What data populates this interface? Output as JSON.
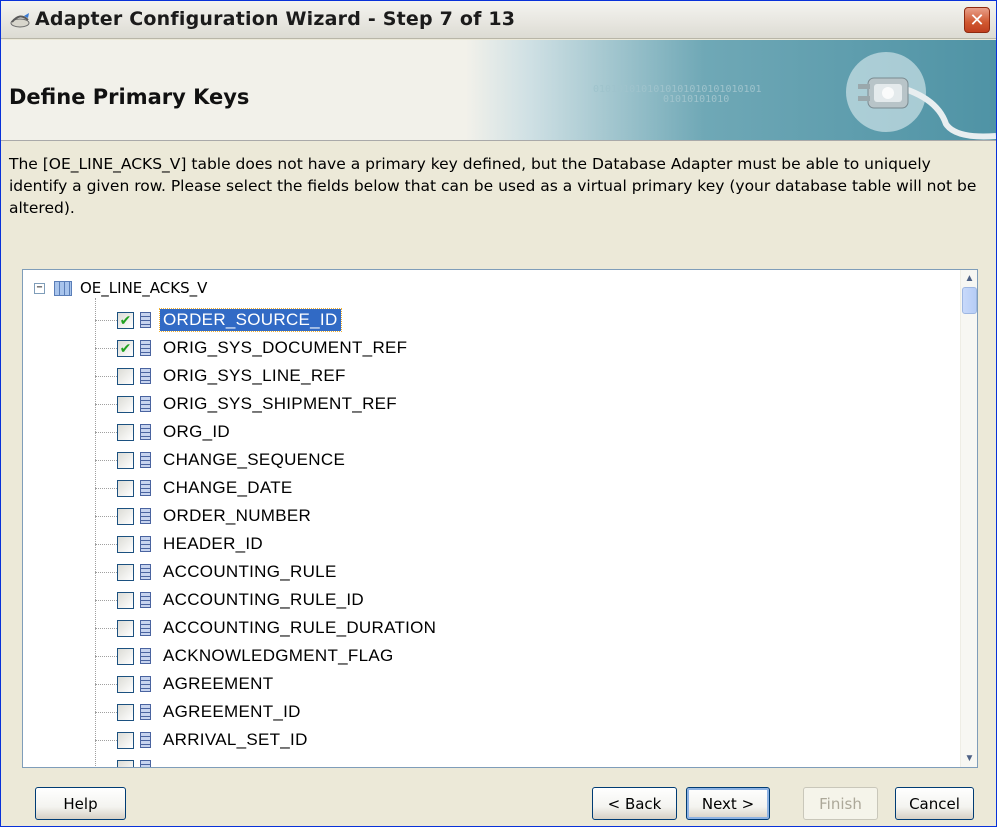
{
  "window": {
    "title": "Adapter Configuration Wizard - Step 7 of 13",
    "close_glyph": "✕"
  },
  "banner": {
    "title": "Define Primary Keys",
    "binary_line1": "0101010101010101010101010101",
    "binary_line2": "01010101010"
  },
  "description": "The [OE_LINE_ACKS_V] table does not have a primary key defined, but the Database Adapter must be able to uniquely identify a given row.  Please select the fields below that can be used as a virtual primary key (your database table will not be altered).",
  "tree": {
    "expander_glyph": "−",
    "root_label": "OE_LINE_ACKS_V",
    "items": [
      {
        "label": "ORDER_SOURCE_ID",
        "checked": true,
        "selected": true
      },
      {
        "label": "ORIG_SYS_DOCUMENT_REF",
        "checked": true,
        "selected": false
      },
      {
        "label": "ORIG_SYS_LINE_REF",
        "checked": false,
        "selected": false
      },
      {
        "label": "ORIG_SYS_SHIPMENT_REF",
        "checked": false,
        "selected": false
      },
      {
        "label": "ORG_ID",
        "checked": false,
        "selected": false
      },
      {
        "label": "CHANGE_SEQUENCE",
        "checked": false,
        "selected": false
      },
      {
        "label": "CHANGE_DATE",
        "checked": false,
        "selected": false
      },
      {
        "label": "ORDER_NUMBER",
        "checked": false,
        "selected": false
      },
      {
        "label": "HEADER_ID",
        "checked": false,
        "selected": false
      },
      {
        "label": "ACCOUNTING_RULE",
        "checked": false,
        "selected": false
      },
      {
        "label": "ACCOUNTING_RULE_ID",
        "checked": false,
        "selected": false
      },
      {
        "label": "ACCOUNTING_RULE_DURATION",
        "checked": false,
        "selected": false
      },
      {
        "label": "ACKNOWLEDGMENT_FLAG",
        "checked": false,
        "selected": false
      },
      {
        "label": "AGREEMENT",
        "checked": false,
        "selected": false
      },
      {
        "label": "AGREEMENT_ID",
        "checked": false,
        "selected": false
      },
      {
        "label": "ARRIVAL_SET_ID",
        "checked": false,
        "selected": false
      },
      {
        "label": "",
        "checked": false,
        "selected": false
      }
    ],
    "scroll_up_glyph": "▲",
    "scroll_down_glyph": "▼"
  },
  "buttons": {
    "help": "Help",
    "back": "< Back",
    "next": "Next >",
    "finish": "Finish",
    "cancel": "Cancel"
  },
  "colors": {
    "selection": "#316ac5",
    "check": "#21a121",
    "window_bg": "#ece9d8"
  }
}
